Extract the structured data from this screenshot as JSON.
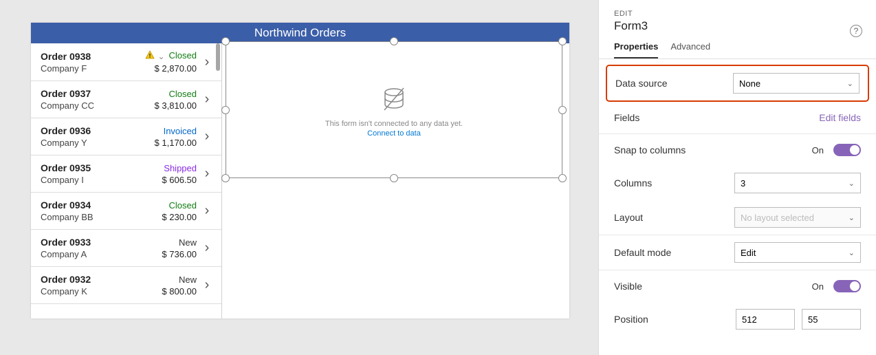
{
  "app": {
    "title": "Northwind Orders",
    "empty_form_msg": "This form isn't connected to any data yet.",
    "connect_link": "Connect to data"
  },
  "orders": [
    {
      "id": "Order 0938",
      "company": "Company F",
      "status": "Closed",
      "amount": "$ 2,870.00",
      "warn": true
    },
    {
      "id": "Order 0937",
      "company": "Company CC",
      "status": "Closed",
      "amount": "$ 3,810.00"
    },
    {
      "id": "Order 0936",
      "company": "Company Y",
      "status": "Invoiced",
      "amount": "$ 1,170.00"
    },
    {
      "id": "Order 0935",
      "company": "Company I",
      "status": "Shipped",
      "amount": "$ 606.50"
    },
    {
      "id": "Order 0934",
      "company": "Company BB",
      "status": "Closed",
      "amount": "$ 230.00"
    },
    {
      "id": "Order 0933",
      "company": "Company A",
      "status": "New",
      "amount": "$ 736.00"
    },
    {
      "id": "Order 0932",
      "company": "Company K",
      "status": "New",
      "amount": "$ 800.00"
    }
  ],
  "panel": {
    "edit_label": "EDIT",
    "control_name": "Form3",
    "tabs": {
      "properties": "Properties",
      "advanced": "Advanced"
    },
    "data_source_label": "Data source",
    "data_source_value": "None",
    "fields_label": "Fields",
    "edit_fields": "Edit fields",
    "snap_label": "Snap to columns",
    "snap_value": "On",
    "columns_label": "Columns",
    "columns_value": "3",
    "layout_label": "Layout",
    "layout_value": "No layout selected",
    "default_mode_label": "Default mode",
    "default_mode_value": "Edit",
    "visible_label": "Visible",
    "visible_value": "On",
    "position_label": "Position",
    "position_x": "512",
    "position_y": "55"
  }
}
